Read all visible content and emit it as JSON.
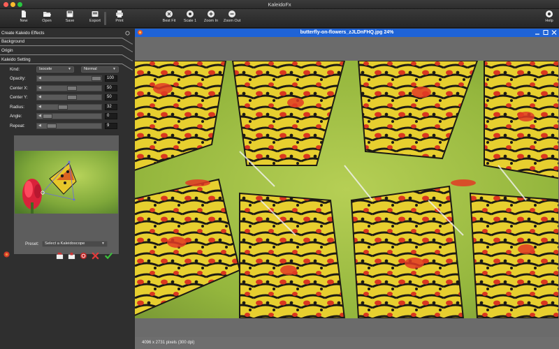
{
  "window": {
    "title": "KaleidoFx"
  },
  "toolbar": {
    "new": "New",
    "open": "Open",
    "save": "Save",
    "export": "Export",
    "print": "Print",
    "best_fit": "Best Fit",
    "scale_1": "Scale 1",
    "zoom_in": "Zoom In",
    "zoom_out": "Zoom Out",
    "help": "Help"
  },
  "panel": {
    "sections": {
      "create": "Create Kaleido Effects",
      "background": "Background",
      "origin": "Origin",
      "kaleido_setting": "Kaleido Setting"
    },
    "kind": {
      "label": "Kind:",
      "value": "Isocele",
      "mode": "Normal"
    },
    "opacity": {
      "label": "Opacity:",
      "value": "100",
      "level": 1.0
    },
    "center_x": {
      "label": "Center X:",
      "value": "50",
      "level": 0.5
    },
    "center_y": {
      "label": "Center Y:",
      "value": "50",
      "level": 0.5
    },
    "radius": {
      "label": "Radius:",
      "value": "32",
      "level": 0.32
    },
    "angle": {
      "label": "Angle:",
      "value": "0",
      "level": 0.0
    },
    "repeat": {
      "label": "Repeat:",
      "value": "9",
      "level": 0.09
    },
    "preset": {
      "label": "Preset:",
      "value": "Select a Kaleidoscope"
    }
  },
  "document": {
    "title": "butterfly-on-flowers_zJLDnFHQ.jpg 24%",
    "status": "4096 x 2731 pixels (300 dpi)"
  },
  "colors": {
    "titlebar_accent": "#1f63d6",
    "close": "#fe5f57",
    "minimize": "#febc2e",
    "maximize": "#28c840"
  }
}
